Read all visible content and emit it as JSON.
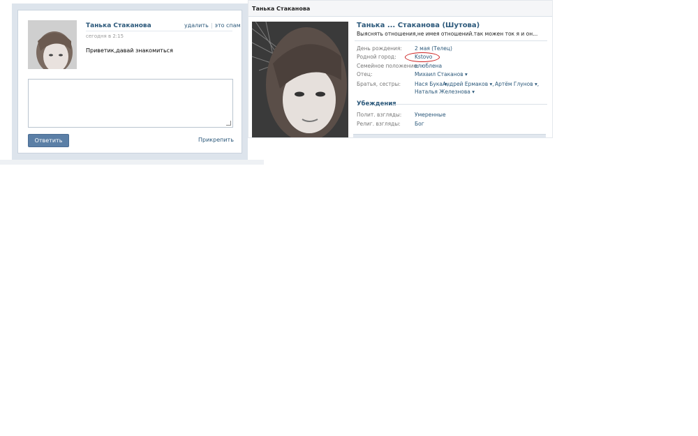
{
  "message": {
    "author": "Танька Стаканова",
    "time": "сегодня в 2:15",
    "delete_label": "удалить",
    "spam_label": "это спам",
    "text": "Приветик,давай знакомиться",
    "reply_placeholder": "",
    "reply_button": "Ответить",
    "attach_label": "Прикрепить"
  },
  "profile": {
    "header_title": "Танька Стаканова",
    "full_name": "Танька ... Стаканова (Шутова)",
    "status": "Выяснять отношения,не имея отношений.так можен ток я и он...",
    "info": [
      {
        "label": "День рождения:",
        "value": "2 мая (Телец)",
        "link": true
      },
      {
        "label": "Родной город:",
        "value": "Kstovo",
        "link": true
      },
      {
        "label": "Семейное положение:",
        "value": "влюблена",
        "link": true
      },
      {
        "label": "Отец:",
        "value": "Михаил Стаканов ▾",
        "link": true
      }
    ],
    "siblings_label": "Братья, сестры:",
    "siblings": [
      "Нася Бука ▾,",
      "Андрей Ермаков ▾,",
      "Артём Глунов ▾,",
      "Наталья Железнова ▾"
    ],
    "beliefs_title": "Убеждения",
    "beliefs": [
      {
        "label": "Полит. взгляды:",
        "value": "Умеренные"
      },
      {
        "label": "Религ. взгляды:",
        "value": "Бог"
      }
    ]
  },
  "colors": {
    "link": "#2b587a",
    "button": "#5b7fa6",
    "annotation": "#cc1f1f"
  }
}
